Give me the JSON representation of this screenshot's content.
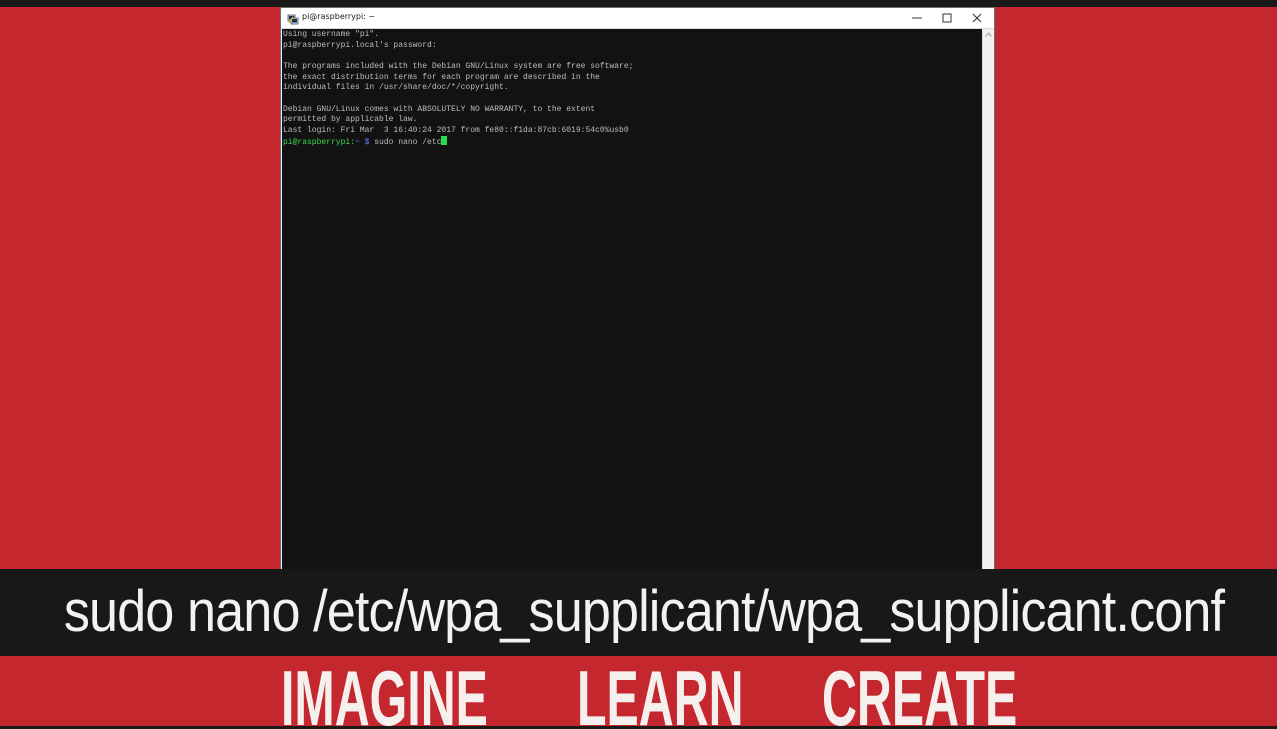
{
  "window": {
    "title": "pi@raspberrypi: ~"
  },
  "terminal": {
    "lines": [
      "Using username \"pi\".",
      "pi@raspberrypi.local's password:",
      "",
      "The programs included with the Debian GNU/Linux system are free software;",
      "the exact distribution terms for each program are described in the",
      "individual files in /usr/share/doc/*/copyright.",
      "",
      "Debian GNU/Linux comes with ABSOLUTELY NO WARRANTY, to the extent",
      "permitted by applicable law.",
      "Last login: Fri Mar  3 16:40:24 2017 from fe80::f1da:87cb:6019:54c0%usb0"
    ],
    "prompt_user": "pi@raspberrypi",
    "prompt_sep": ":",
    "prompt_path": "~ $",
    "command": " sudo nano /etc"
  },
  "caption": {
    "text": "sudo nano /etc/wpa_supplicant/wpa_supplicant.conf"
  },
  "motto": {
    "words": [
      "IMAGINE",
      "LEARN",
      "CREATE"
    ]
  },
  "colors": {
    "background_red": "#c4272d",
    "terminal_bg": "#121212",
    "prompt_green": "#37d94a",
    "prompt_blue": "#6e7eff"
  },
  "icons": {
    "app": "putty-icon",
    "minimize": "minimize-icon",
    "maximize": "maximize-icon",
    "close": "close-icon"
  }
}
